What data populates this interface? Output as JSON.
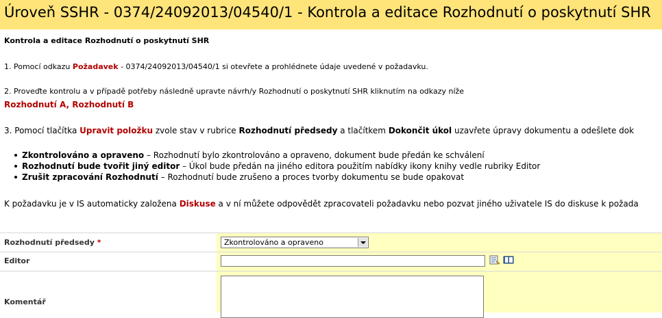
{
  "window": {
    "title": "Úroveň SSHR - 0374/24092013/04540/1 - Kontrola a editace Rozhodnutí o poskytnutí SHR"
  },
  "intro": {
    "heading": "Kontrola a editace Rozhodnutí  o poskytnutí SHR",
    "step1_prefix": "1.  Pomocí odkazu ",
    "step1_link": "Požadavek",
    "step1_suffix": " - 0374/24092013/04540/1 si otevřete a prohlédnete údaje uvedené v požadavku.",
    "step2_text": "2. Proveďte kontrolu a v případě potřeby následně upravte návrh/y Rozhodnutí o poskytnutí SHR kliknutím na odkazy níže",
    "step2_link_a": "Rozhodnutí A",
    "step2_sep": ", ",
    "step2_link_b": "Rozhodnutí B",
    "step3_prefix": "3. Pomocí tlačítka ",
    "step3_link": "Upravit položku",
    "step3_mid1": " zvole stav v rubrice ",
    "step3_bold1": "Rozhodnutí předsedy",
    "step3_mid2": " a tlačítkem ",
    "step3_bold2": "Dokončit úkol",
    "step3_suffix": " uzavřete úpravy dokumentu a odešlete dok",
    "bullets": [
      {
        "bold": "Zkontrolováno a opraveno",
        "text": " – Rozhodnutí bylo zkontrolováno a opraveno, dokument bude předán ke schválení"
      },
      {
        "bold": "Rozhodnutí bude tvořit jiný editor",
        "text": " – Úkol bude předán na jiného editora použitím nabídky ikony knihy vedle rubriky Editor"
      },
      {
        "bold": "Zrušit zpracování Rozhodnutí",
        "text": " – Rozhodnutí bude zrušeno a proces tvorby dokumentu se bude opakovat"
      }
    ],
    "disc_prefix": "K požadavku je v IS automaticky založena ",
    "disc_link": "Diskuse",
    "disc_suffix": " a v ní můžete odpovědět zpracovateli požadavku nebo pozvat jiného uživatele IS do diskuse k požada"
  },
  "form": {
    "decision_label": "Rozhodnutí předsedy",
    "required_marker": " *",
    "decision_value": "Zkontrolováno a opraveno",
    "editor_label": "Editor",
    "editor_value": "",
    "comment_label": "Komentář",
    "comment_value": ""
  },
  "icons": {
    "check_names": "check-names-icon",
    "browse": "address-book-icon"
  },
  "colors": {
    "title_bg": "#ffe47a",
    "link": "#b20000",
    "field_bg": "#ffffc0"
  }
}
